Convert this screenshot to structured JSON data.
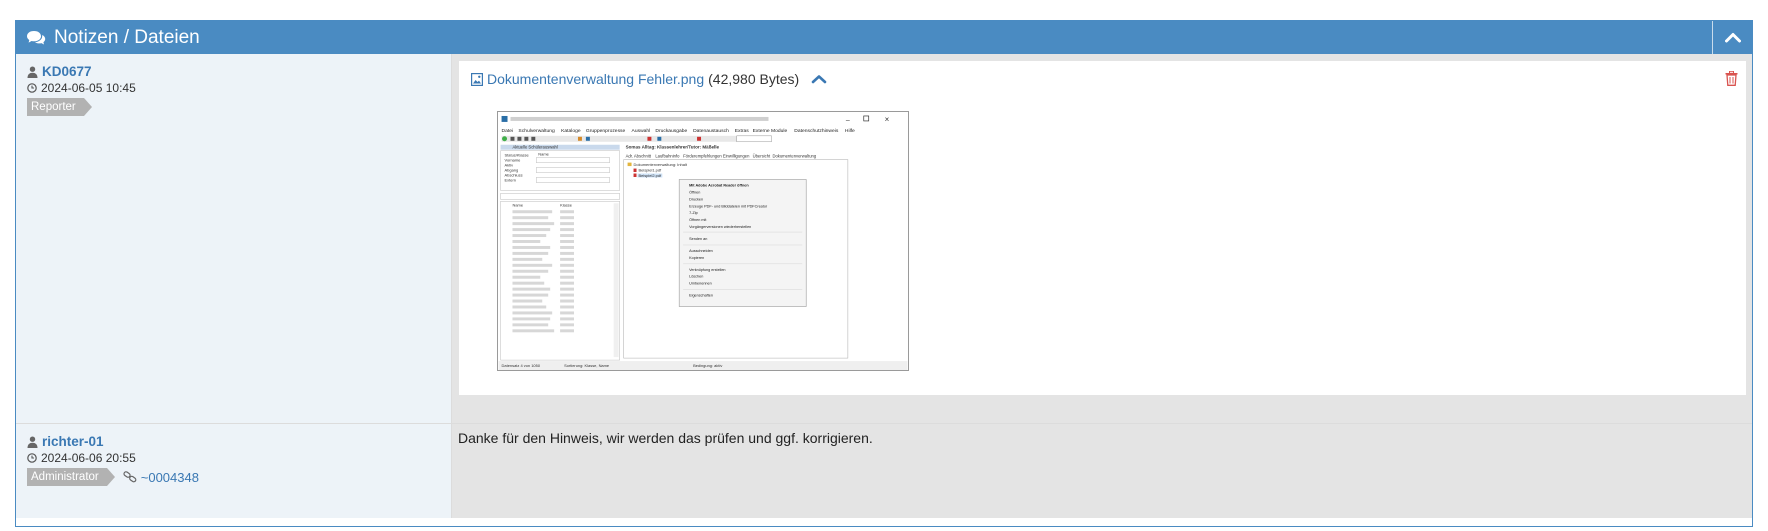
{
  "panel": {
    "title": "Notizen / Dateien"
  },
  "notes": [
    {
      "user": "KD0677",
      "datetime": "2024-06-05 10:45",
      "role": "Reporter",
      "attachment": {
        "name": "Dokumentenverwaltung Fehler.png",
        "size": "(42,980 Bytes)"
      }
    },
    {
      "user": "richter-01",
      "datetime": "2024-06-06 20:55",
      "role": "Administrator",
      "link": "~0004348",
      "text": "Danke für den Hinweis, wir werden das prüfen und ggf. korrigieren."
    }
  ],
  "screenshot_thumb": {
    "header_text": "Somas Alltag: Klassenlehrer/Tutor: Mäßelle",
    "menu": [
      "Datei",
      "Schulverwaltung",
      "Kataloge",
      "Gruppenprozesse",
      "Auswahl",
      "Druckausgabe",
      "Datenaustausch",
      "Extras",
      "Externe Module",
      "Datenschutzhinweis",
      "Hilfe"
    ],
    "tabs": [
      "Adr. Abschnitt",
      "Laufbahninfo",
      "Förderempfehlungen",
      "Einwilligungen",
      "Übersicht",
      "Dokumentenverwaltung"
    ],
    "tree_root": "Dokumentenverwaltung: Inhalt",
    "files": [
      "Beispiel1.pdf",
      "Beispiel2.pdf"
    ],
    "context_menu": [
      "Mit Adobe Acrobat Reader öffnen",
      "Öffnen",
      "Drucken",
      "Erzeuge PDF- und Bilddateien mit PDFCreator",
      "7-Zip",
      "Öffnen mit",
      "Vorgängerversionen wiederherstellen",
      "Senden an",
      "Ausschneiden",
      "Kopieren",
      "Verknüpfung erstellen",
      "Löschen",
      "Umbenennen",
      "Eigenschaften"
    ],
    "left_header": "Aktuelle Schülerauswahl",
    "left_fields": [
      "Status/Klasse",
      "Vorname",
      "Abgang",
      "Abschluss",
      "Extern"
    ],
    "status_bar": [
      "Datensatz 4 von 1050",
      "Sortierung: Klasse, Name",
      "Bedingung: aktiv"
    ],
    "colors": {
      "accent": "#4a8bc2",
      "link": "#3a78b3",
      "delete": "#d9534f"
    }
  }
}
